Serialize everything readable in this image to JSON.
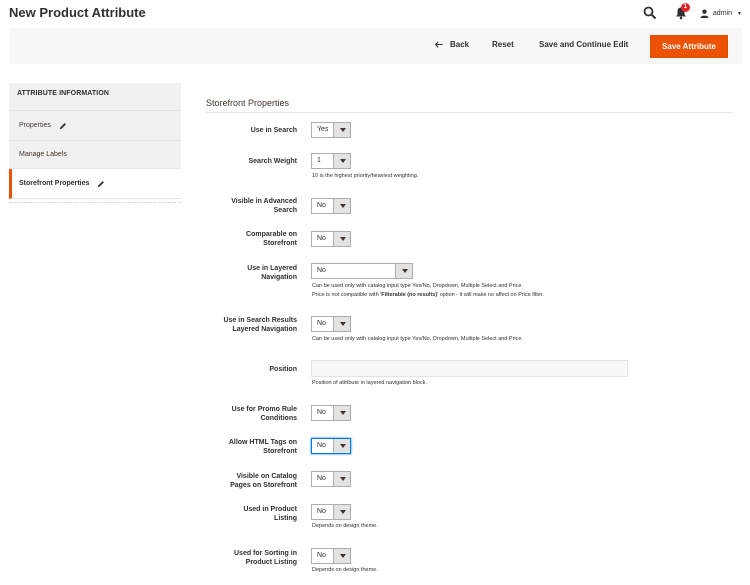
{
  "header": {
    "title": "New Product Attribute",
    "notification_count": "1",
    "user_name": "admin"
  },
  "actions": {
    "back_label": "Back",
    "reset_label": "Reset",
    "save_continue_label": "Save and Continue Edit",
    "save_label": "Save Attribute"
  },
  "sidebar": {
    "title": "ATTRIBUTE INFORMATION",
    "items": [
      {
        "label": "Properties"
      },
      {
        "label": "Manage Labels"
      },
      {
        "label": "Storefront Properties"
      }
    ]
  },
  "section": {
    "title": "Storefront Properties"
  },
  "fields": {
    "use_in_search": {
      "label": "Use in Search",
      "value": "Yes"
    },
    "search_weight": {
      "label": "Search Weight",
      "value": "1",
      "note": "10 is the highest priority/heaviest weighting."
    },
    "visible_advanced": {
      "label_1": "Visible in Advanced",
      "label_2": "Search",
      "value": "No"
    },
    "comparable": {
      "label_1": "Comparable on",
      "label_2": "Storefront",
      "value": "No"
    },
    "layered_nav": {
      "label_1": "Use in Layered",
      "label_2": "Navigation",
      "value": "No",
      "note_1": "Can be used only with catalog input type Yes/No, Dropdown, Multiple Select and Price.",
      "note_2_a": "Price is not compatible with '",
      "note_2_b": "Filterable (no results)",
      "note_2_c": "' option - it will make no affect on Price filter."
    },
    "search_layered": {
      "label_1": "Use in Search Results",
      "label_2": "Layered Navigation",
      "value": "No",
      "note": "Can be used only with catalog input type Yes/No, Dropdown, Multiple Select and Price."
    },
    "position": {
      "label": "Position",
      "value": "",
      "note": "Position of attribute in layered navigation block."
    },
    "promo_rule": {
      "label_1": "Use for Promo Rule",
      "label_2": "Conditions",
      "value": "No"
    },
    "html_tags": {
      "label_1": "Allow HTML Tags on",
      "label_2": "Storefront",
      "value": "No"
    },
    "visible_catalog": {
      "label_1": "Visible on Catalog",
      "label_2": "Pages on Storefront",
      "value": "No"
    },
    "product_listing": {
      "label_1": "Used in Product",
      "label_2": "Listing",
      "value": "No",
      "note": "Depends on design theme."
    },
    "sorting": {
      "label_1": "Used for Sorting in",
      "label_2": "Product Listing",
      "value": "No",
      "note": "Depends on design theme."
    }
  }
}
